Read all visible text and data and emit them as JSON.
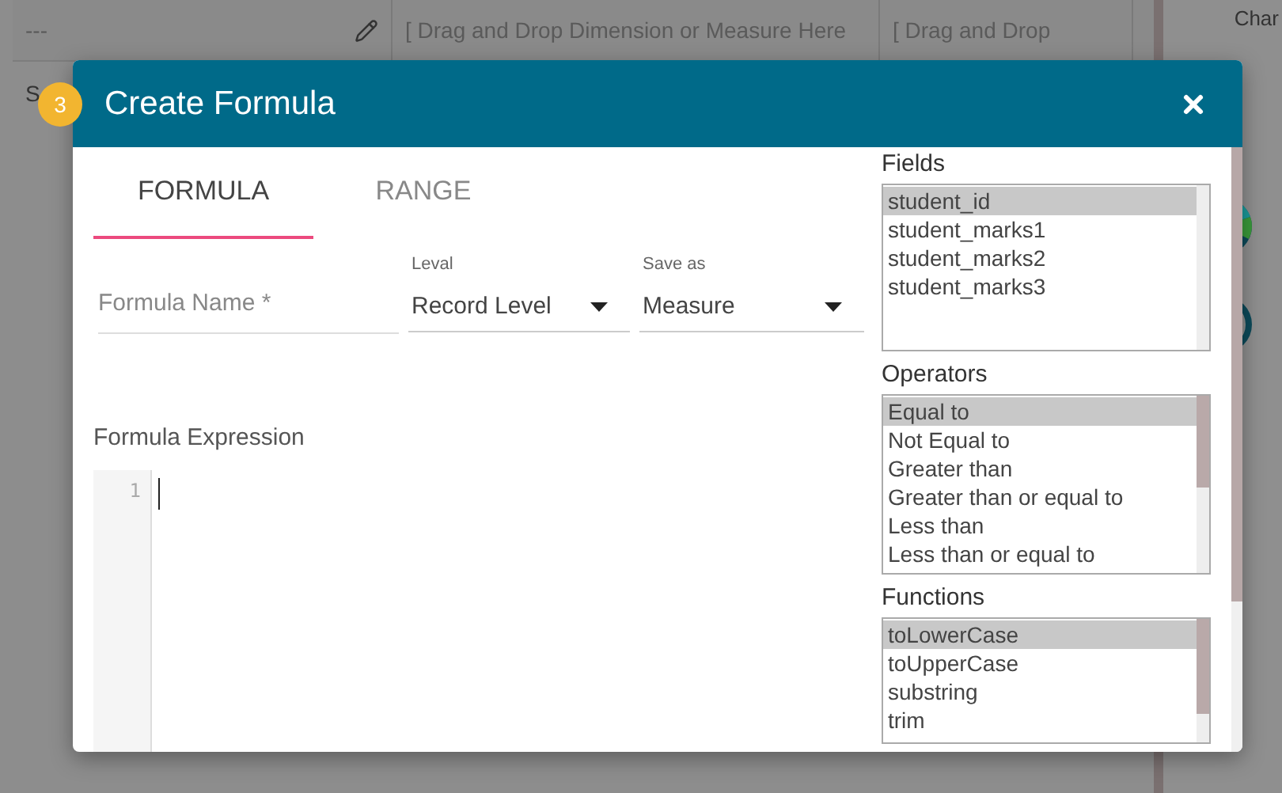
{
  "background": {
    "header_cells": [
      "---",
      "[ Drag and Drop Dimension or Measure Here",
      "[ Drag and Drop"
    ],
    "side_label": "S",
    "panel_title": "Char"
  },
  "step_badge": "3",
  "dialog": {
    "title": "Create Formula",
    "tabs": [
      {
        "label": "FORMULA",
        "selected": true
      },
      {
        "label": "RANGE",
        "selected": false
      }
    ],
    "formula_name": {
      "placeholder": "Formula Name *"
    },
    "selects": [
      {
        "label": "Leval",
        "value": "Record Level"
      },
      {
        "label": "Save as",
        "value": "Measure"
      }
    ],
    "expression": {
      "label": "Formula Expression",
      "line_numbers": [
        "1"
      ]
    },
    "lists": [
      {
        "title": "Fields",
        "items": [
          {
            "label": "student_id",
            "selected": true
          },
          {
            "label": "student_marks1",
            "selected": false
          },
          {
            "label": "student_marks2",
            "selected": false
          },
          {
            "label": "student_marks3",
            "selected": false
          }
        ]
      },
      {
        "title": "Operators",
        "items": [
          {
            "label": "Equal to",
            "selected": true
          },
          {
            "label": "Not Equal to",
            "selected": false
          },
          {
            "label": "Greater than",
            "selected": false
          },
          {
            "label": "Greater than or equal to",
            "selected": false
          },
          {
            "label": "Less than",
            "selected": false
          },
          {
            "label": "Less than or equal to",
            "selected": false
          }
        ]
      },
      {
        "title": "Functions",
        "items": [
          {
            "label": "toLowerCase",
            "selected": true
          },
          {
            "label": "toUpperCase",
            "selected": false
          },
          {
            "label": "substring",
            "selected": false
          },
          {
            "label": "trim",
            "selected": false
          }
        ]
      }
    ]
  }
}
